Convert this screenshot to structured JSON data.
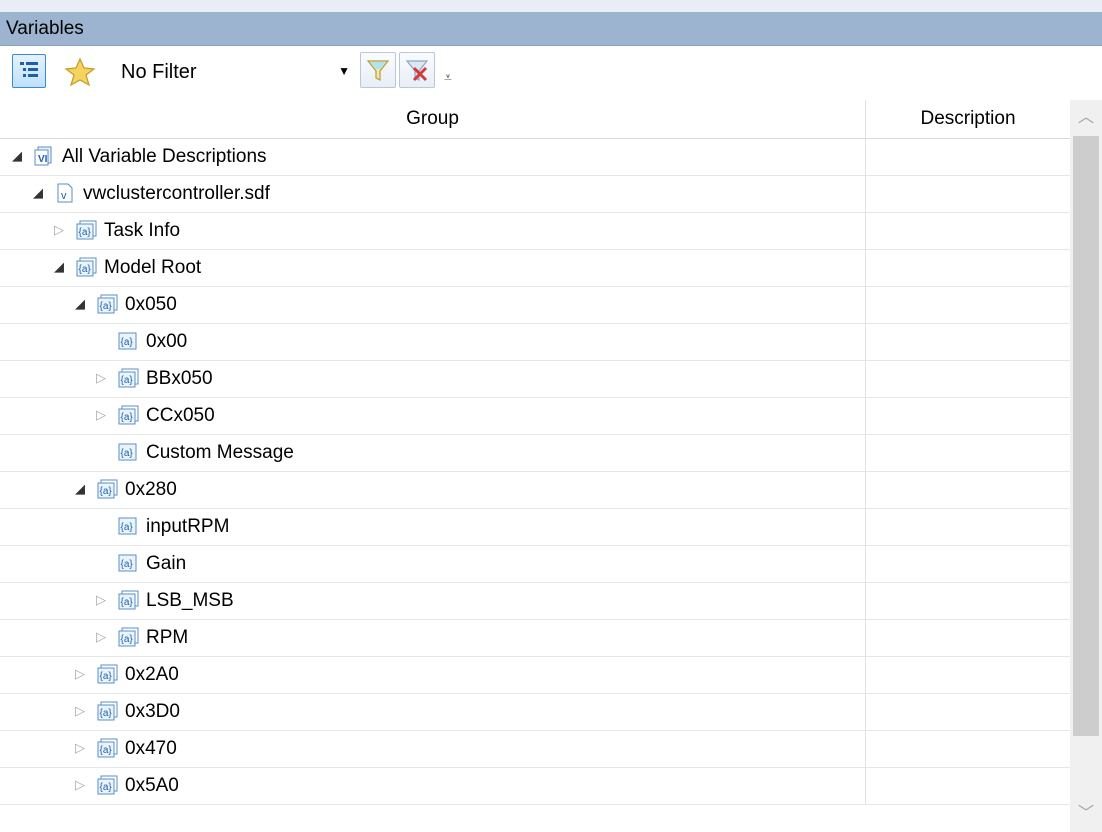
{
  "panel": {
    "title": "Variables"
  },
  "toolbar": {
    "filter_value": "No Filter"
  },
  "grid": {
    "columns": {
      "group": "Group",
      "description": "Description"
    },
    "rows": [
      {
        "label": "All Variable Descriptions",
        "level": 0,
        "expander": "open",
        "icon": "variable-descriptions-icon",
        "description": ""
      },
      {
        "label": "vwclustercontroller.sdf",
        "level": 1,
        "expander": "open",
        "icon": "sdf-file-icon",
        "description": ""
      },
      {
        "label": "Task Info",
        "level": 2,
        "expander": "closed",
        "icon": "variable-group-icon",
        "description": ""
      },
      {
        "label": "Model Root",
        "level": 2,
        "expander": "open",
        "icon": "variable-group-icon",
        "description": ""
      },
      {
        "label": "0x050",
        "level": 3,
        "expander": "open",
        "icon": "variable-group-icon",
        "description": ""
      },
      {
        "label": "0x00",
        "level": 4,
        "expander": "none",
        "icon": "variable-icon",
        "description": ""
      },
      {
        "label": "BBx050",
        "level": 4,
        "expander": "closed",
        "icon": "variable-group-icon",
        "description": ""
      },
      {
        "label": "CCx050",
        "level": 4,
        "expander": "closed",
        "icon": "variable-group-icon",
        "description": ""
      },
      {
        "label": "Custom Message",
        "level": 4,
        "expander": "none",
        "icon": "variable-icon",
        "description": ""
      },
      {
        "label": "0x280",
        "level": 3,
        "expander": "open",
        "icon": "variable-group-icon",
        "description": ""
      },
      {
        "label": "inputRPM",
        "level": 4,
        "expander": "none",
        "icon": "variable-icon",
        "description": ""
      },
      {
        "label": "Gain",
        "level": 4,
        "expander": "none",
        "icon": "variable-icon",
        "description": ""
      },
      {
        "label": "LSB_MSB",
        "level": 4,
        "expander": "closed",
        "icon": "variable-group-icon",
        "description": ""
      },
      {
        "label": "RPM",
        "level": 4,
        "expander": "closed",
        "icon": "variable-group-icon",
        "description": ""
      },
      {
        "label": "0x2A0",
        "level": 3,
        "expander": "closed",
        "icon": "variable-group-icon",
        "description": ""
      },
      {
        "label": "0x3D0",
        "level": 3,
        "expander": "closed",
        "icon": "variable-group-icon",
        "description": ""
      },
      {
        "label": "0x470",
        "level": 3,
        "expander": "closed",
        "icon": "variable-group-icon",
        "description": ""
      },
      {
        "label": "0x5A0",
        "level": 3,
        "expander": "closed",
        "icon": "variable-group-icon",
        "description": ""
      }
    ]
  }
}
